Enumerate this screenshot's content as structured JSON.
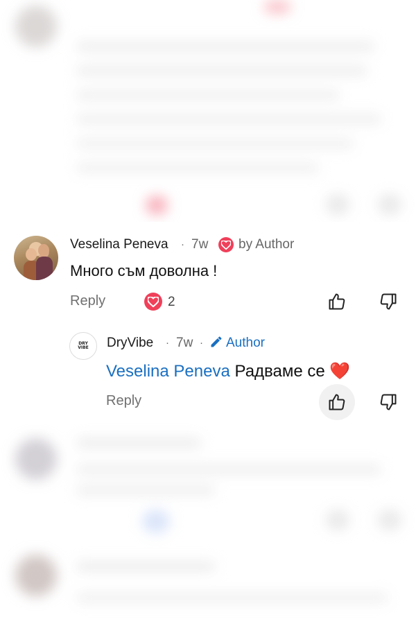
{
  "comments": [
    {
      "author": "Veselina Peneva",
      "dot": "·",
      "time": "7w",
      "loved_by": "by Author",
      "text": "Много съм доволна !",
      "reply_label": "Reply",
      "reactions": {
        "count": "2",
        "type": "heart"
      }
    },
    {
      "author": "DryVibe",
      "avatar_text": "DRY VIBE",
      "dot": "·",
      "time": "7w",
      "dot2": "·",
      "author_badge": "Author",
      "mention": "Veselina Peneva",
      "text": "Радваме се",
      "emoji": "❤️",
      "reply_label": "Reply"
    }
  ],
  "colors": {
    "accent_blue": "#1a6fc1",
    "heart_red": "#f0405a",
    "muted_text": "#707070",
    "highlight_bg": "#f1f1f1"
  },
  "icons": {
    "like": "thumbs-up-icon",
    "dislike": "thumbs-down-icon",
    "heart": "heart-icon",
    "edit": "pencil-icon"
  }
}
